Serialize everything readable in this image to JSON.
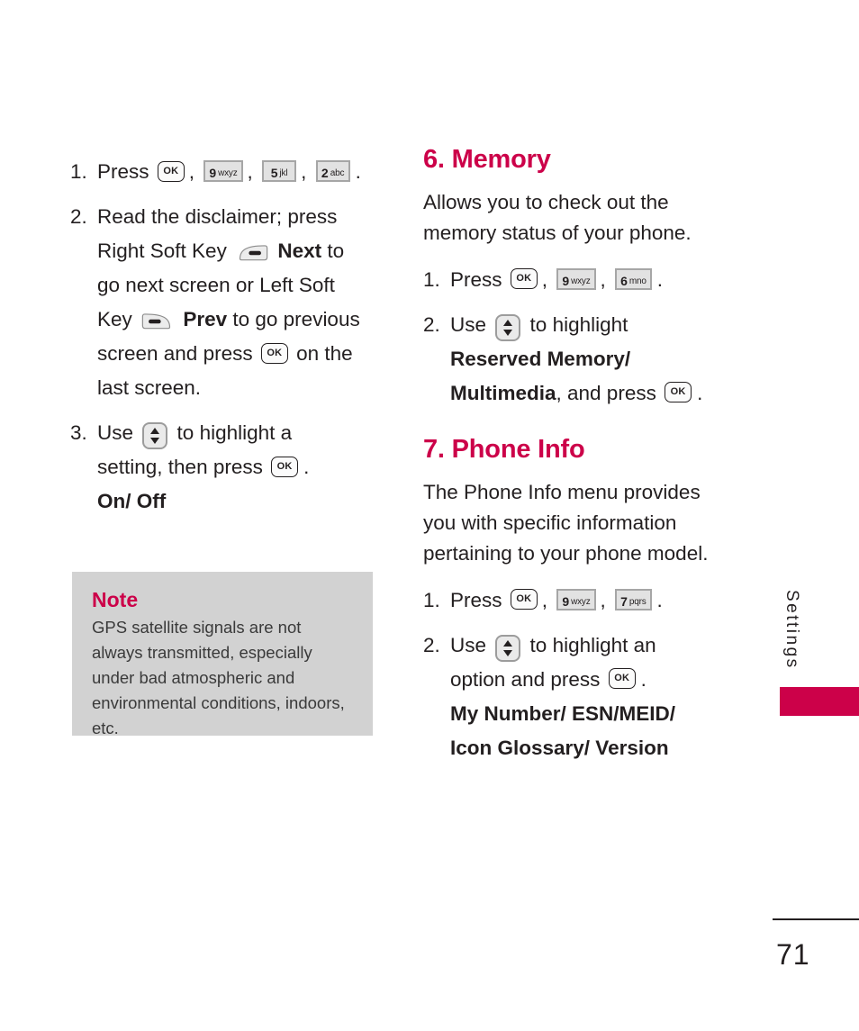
{
  "page": {
    "number": "71",
    "side_tab_label": "Settings",
    "accent_color": "#cc0149",
    "note_bg_color": "#d2d2d2",
    "text_color": "#231f20"
  },
  "left_column": {
    "steps": [
      {
        "num": "1.",
        "lead": "Press",
        "keys": [
          "OK",
          "9 wxyz",
          "5 jkl",
          "2 abc"
        ],
        "trail": "."
      },
      {
        "num": "2.",
        "text_1": "Read the disclaimer; press",
        "text_2": "Right Soft Key",
        "soft_key_right": "right-soft-key",
        "bold_1": "Next",
        "text_3": "to",
        "text_4": "go next screen or Left Soft",
        "text_5": "Key",
        "soft_key_left": "left-soft-key",
        "bold_2": "Prev",
        "text_6": "to go previous",
        "text_7": "screen and press",
        "key_ok": "OK",
        "text_8": "on the",
        "text_9": "last screen."
      },
      {
        "num": "3.",
        "text_1": "Use",
        "nav_key": "navigation-key",
        "text_2": "to highlight a",
        "text_3": "setting, then press",
        "key_ok": "OK",
        "text_4": ".",
        "options": "On/ Off"
      }
    ],
    "note": {
      "title": "Note",
      "body": "GPS satellite signals are not always transmitted, especially under bad atmospheric and environmental conditions, indoors, etc."
    }
  },
  "right_column": {
    "sections": [
      {
        "heading": "6. Memory",
        "intro": "Allows you to check out the memory status of your phone.",
        "steps": [
          {
            "num": "1.",
            "lead": "Press",
            "keys": [
              "OK",
              "9 wxyz",
              "6 mno"
            ],
            "trail": "."
          },
          {
            "num": "2.",
            "text_1": "Use",
            "nav_key": "navigation-key",
            "text_2": "to highlight",
            "bold_1": "Reserved Memory/",
            "bold_2": "Multimedia",
            "text_3": ", and press",
            "key_ok": "OK",
            "text_4": "."
          }
        ]
      },
      {
        "heading": "7. Phone Info",
        "intro": "The Phone Info menu provides you with specific information pertaining to your phone model.",
        "steps": [
          {
            "num": "1.",
            "lead": "Press",
            "keys": [
              "OK",
              "9 wxyz",
              "7 pqrs"
            ],
            "trail": "."
          },
          {
            "num": "2.",
            "text_1": "Use",
            "nav_key": "navigation-key",
            "text_2": "to highlight an",
            "text_3": "option and press",
            "key_ok": "OK",
            "text_4": ".",
            "options_1": "My Number/ ESN/MEID/",
            "options_2": "Icon Glossary/ Version"
          }
        ]
      }
    ]
  },
  "keys": {
    "ok_label": "OK",
    "k9": {
      "digit": "9",
      "letters": "wxyz"
    },
    "k5": {
      "digit": "5",
      "letters": "jkl"
    },
    "k2": {
      "digit": "2",
      "letters": "abc"
    },
    "k6": {
      "digit": "6",
      "letters": "mno"
    },
    "k7": {
      "digit": "7",
      "letters": "pqrs"
    }
  }
}
